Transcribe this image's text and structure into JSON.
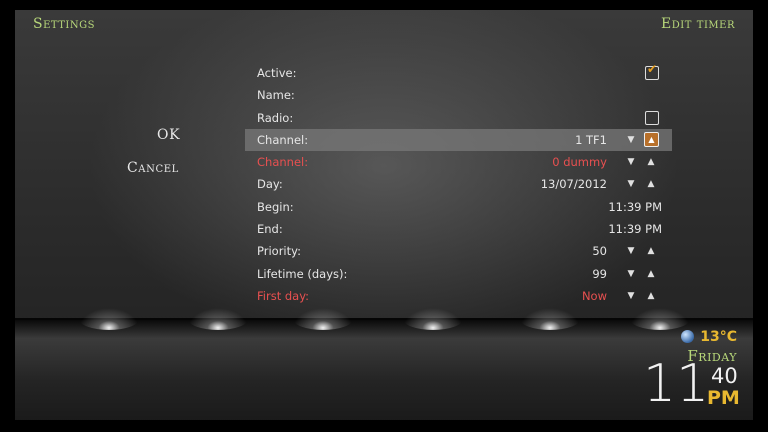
{
  "header": {
    "left_title": "Settings",
    "right_title": "Edit timer"
  },
  "actions": {
    "ok_label": "OK",
    "cancel_label": "Cancel"
  },
  "rows": [
    {
      "label": "Active:",
      "value": "",
      "checked": true
    },
    {
      "label": "Name:",
      "value": ""
    },
    {
      "label": "Radio:",
      "value": "",
      "checked": false
    },
    {
      "label": "Channel:",
      "value": "1 TF1",
      "selected": true
    },
    {
      "label": "Channel:",
      "value": "0 dummy",
      "color": "#e85050"
    },
    {
      "label": "Day:",
      "value": "13/07/2012"
    },
    {
      "label": "Begin:",
      "value": "11:39 PM"
    },
    {
      "label": "End:",
      "value": "11:39 PM"
    },
    {
      "label": "Priority:",
      "value": "50"
    },
    {
      "label": "Lifetime (days):",
      "value": "99"
    },
    {
      "label": "First day:",
      "value": "Now",
      "color": "#e85050"
    }
  ],
  "weather": {
    "temperature": "13°C",
    "icon": "globe-icon"
  },
  "clock": {
    "day": "Friday",
    "hour": "11",
    "minutes": "40",
    "ampm": "PM"
  },
  "icons": {
    "down": "▼",
    "up": "▲",
    "check": "✔"
  },
  "colors": {
    "accent_green": "#b8d87a",
    "accent_orange": "#e8b830",
    "warning_red": "#e85050",
    "selection": "#787878"
  }
}
